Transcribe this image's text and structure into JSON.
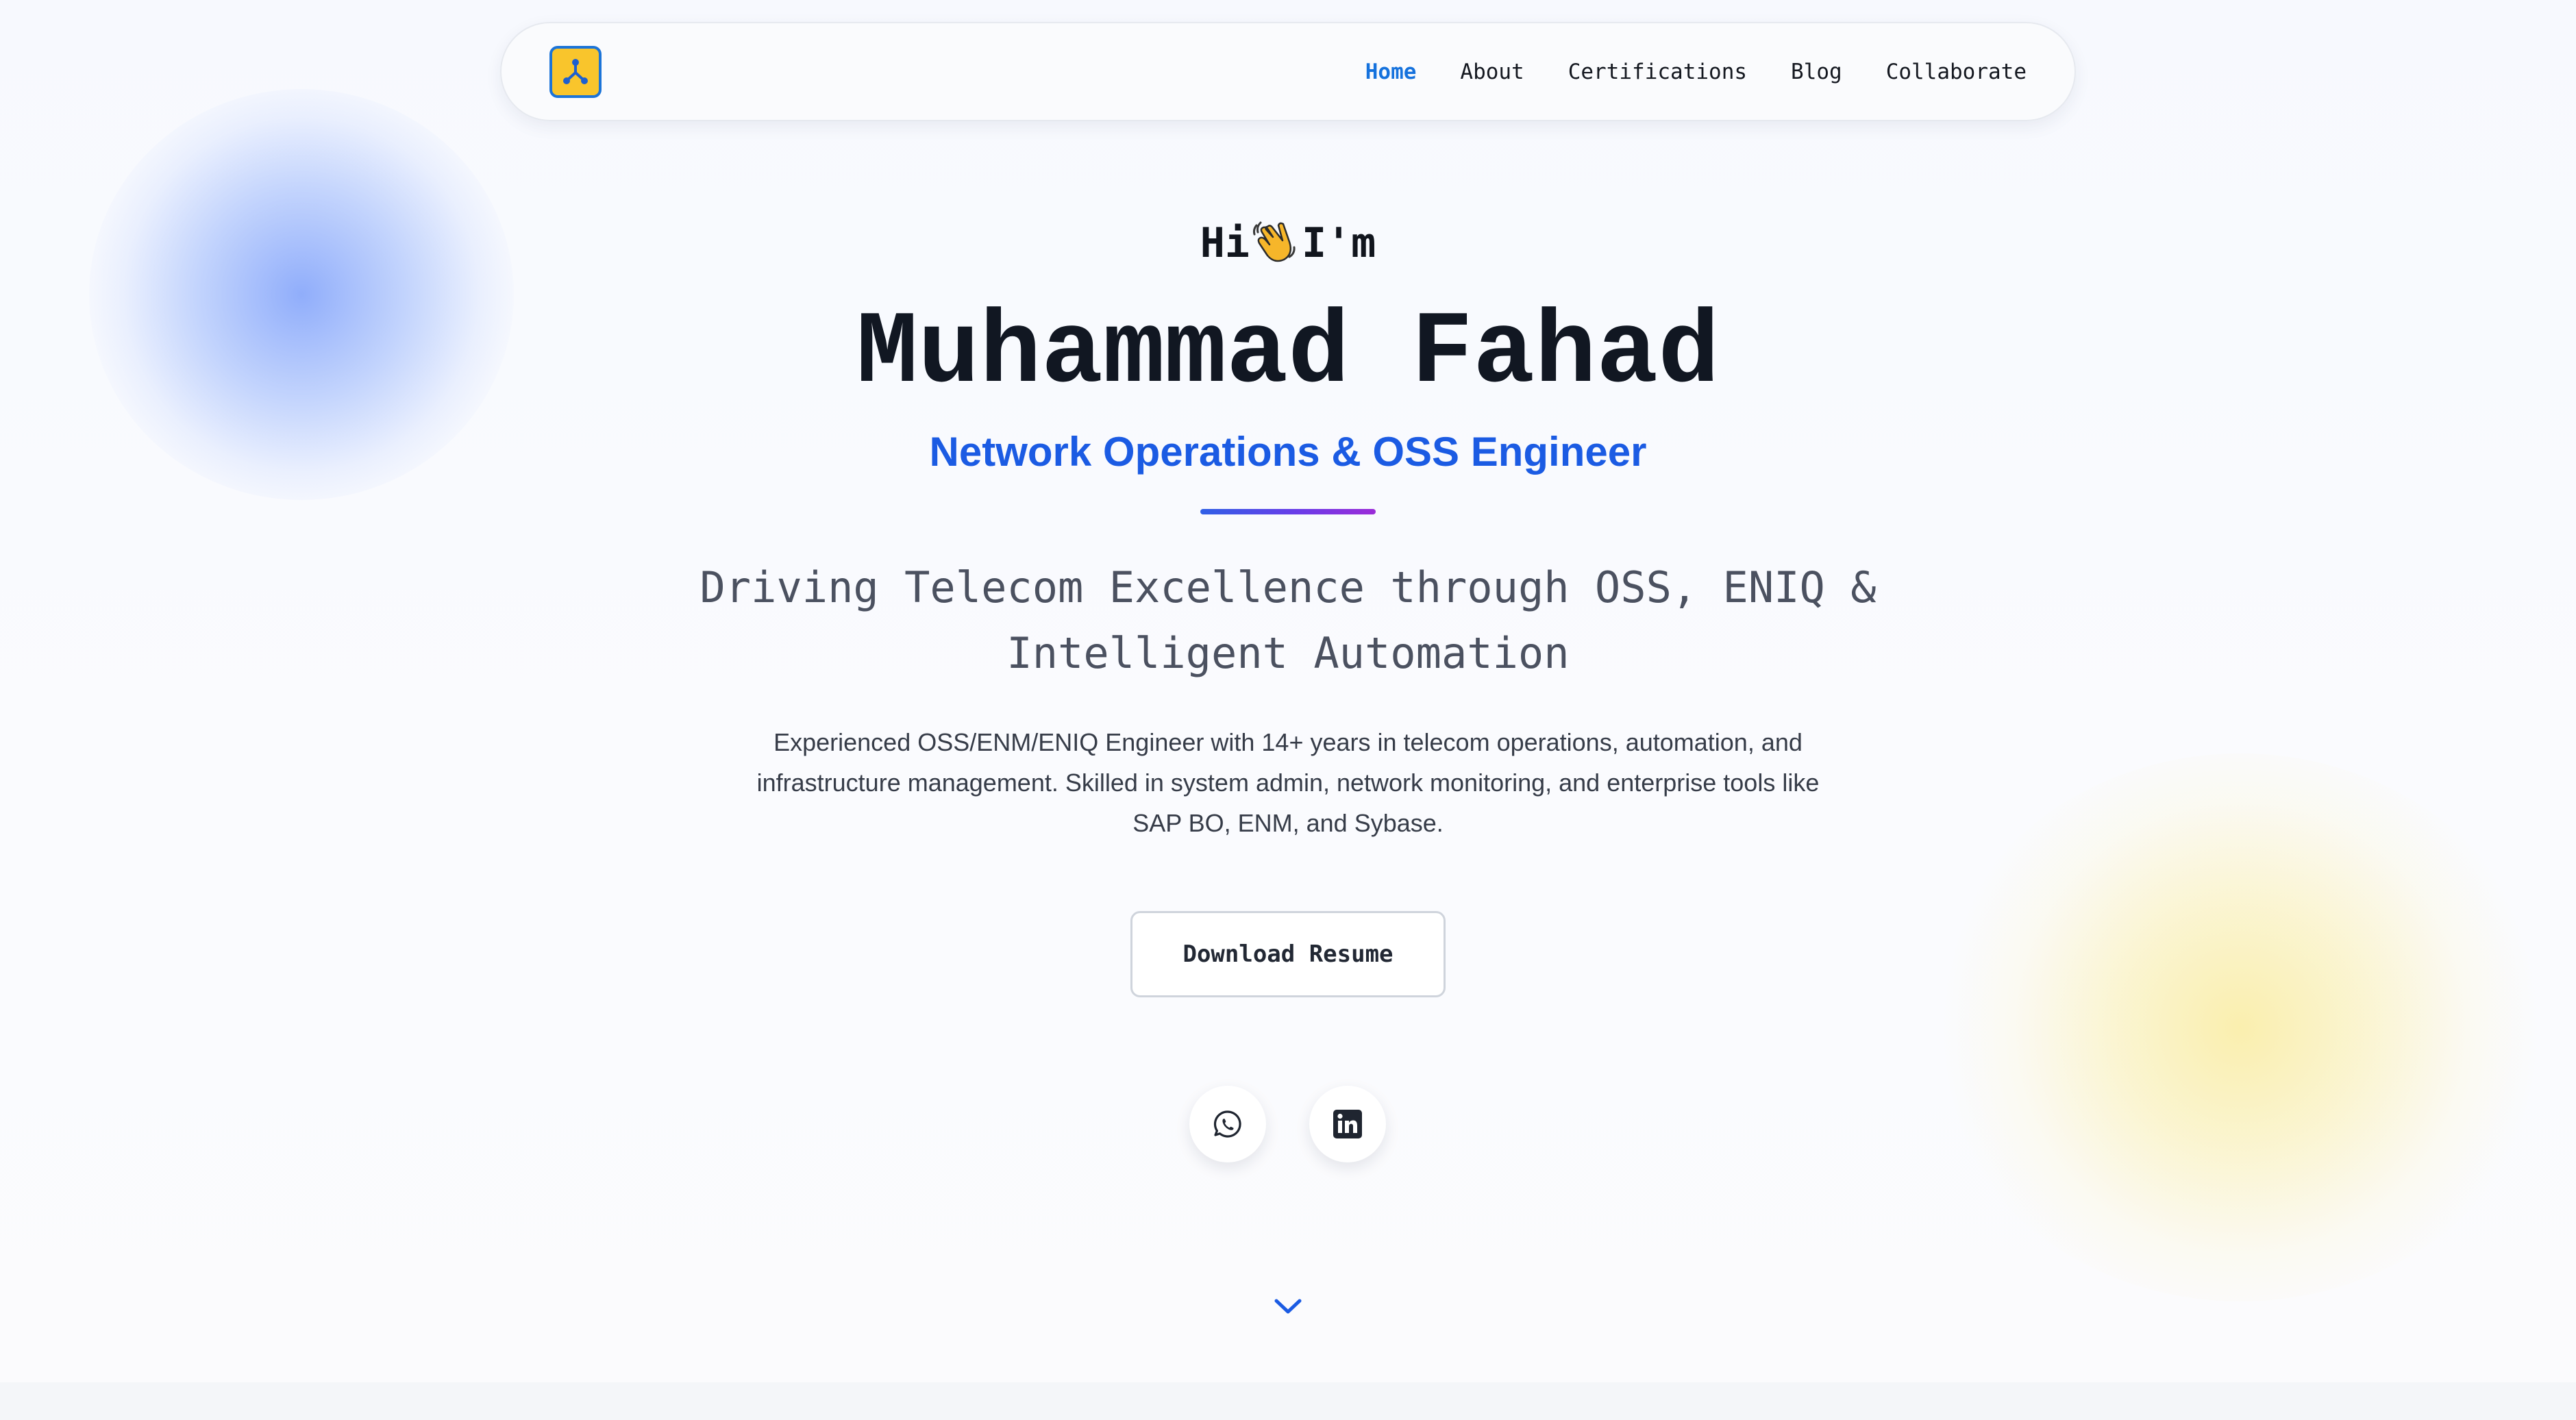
{
  "nav": {
    "logo_icon": "network-nodes-icon",
    "links": [
      {
        "label": "Home",
        "active": true
      },
      {
        "label": "About",
        "active": false
      },
      {
        "label": "Certifications",
        "active": false
      },
      {
        "label": "Blog",
        "active": false
      },
      {
        "label": "Collaborate",
        "active": false
      }
    ]
  },
  "hero": {
    "greeting_before": "Hi",
    "greeting_icon": "waving-hand-icon",
    "greeting_after": "I'm",
    "name": "Muhammad Fahad",
    "role": "Network Operations & OSS Engineer",
    "tagline": "Driving Telecom Excellence through OSS, ENIQ & Intelligent Automation",
    "intro": "Experienced OSS/ENM/ENIQ Engineer with 14+ years in telecom operations, automation, and infrastructure management. Skilled in system admin, network monitoring, and enterprise tools like SAP BO, ENM, and Sybase.",
    "resume_button": "Download Resume",
    "social": [
      {
        "icon": "whatsapp-icon"
      },
      {
        "icon": "linkedin-icon"
      }
    ],
    "scroll_icon": "chevron-down-icon"
  },
  "colors": {
    "accent": "#1572dd",
    "role": "#1b5be3",
    "logo_bg": "#f9c52c",
    "logo_border": "#1c74d8",
    "name": "#111722"
  }
}
